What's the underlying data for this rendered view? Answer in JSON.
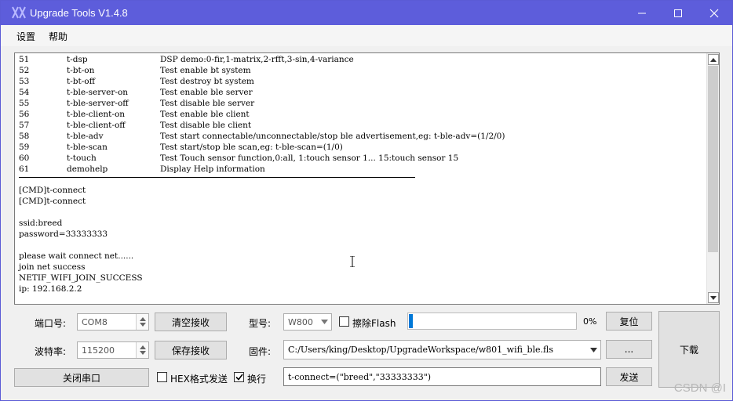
{
  "window": {
    "title": "Upgrade Tools V1.4.8"
  },
  "menu": [
    {
      "label": "设置"
    },
    {
      "label": "帮助"
    }
  ],
  "console": {
    "commands": [
      {
        "num": "51",
        "name": "t-dsp",
        "desc": "DSP demo:0-fir,1-matrix,2-rfft,3-sin,4-variance"
      },
      {
        "num": "52",
        "name": "t-bt-on",
        "desc": "Test enable bt system"
      },
      {
        "num": "53",
        "name": "t-bt-off",
        "desc": "Test destroy bt system"
      },
      {
        "num": "54",
        "name": "t-ble-server-on",
        "desc": "Test enable ble server"
      },
      {
        "num": "55",
        "name": "t-ble-server-off",
        "desc": "Test disable ble server"
      },
      {
        "num": "56",
        "name": "t-ble-client-on",
        "desc": "Test enable ble client"
      },
      {
        "num": "57",
        "name": "t-ble-client-off",
        "desc": "Test disable ble client"
      },
      {
        "num": "58",
        "name": "t-ble-adv",
        "desc": "Test start connectable/unconnectable/stop ble advertisement,eg: t-ble-adv=(1/2/0)"
      },
      {
        "num": "59",
        "name": "t-ble-scan",
        "desc": "Test start/stop ble scan,eg: t-ble-scan=(1/0)"
      },
      {
        "num": "60",
        "name": "t-touch",
        "desc": "Test Touch sensor function,0:all, 1:touch sensor 1... 15:touch sensor 15"
      },
      {
        "num": "61",
        "name": "demohelp",
        "desc": "Display Help information"
      }
    ],
    "log": [
      "[CMD]t-connect",
      "[CMD]t-connect",
      "",
      "ssid:breed",
      "password=33333333",
      "",
      "please wait connect net......",
      "join net success",
      "NETIF_WIFI_JOIN_SUCCESS",
      "ip: 192.168.2.2"
    ]
  },
  "controls": {
    "port_label": "端口号:",
    "port_value": "COM8",
    "baud_label": "波特率:",
    "baud_value": "115200",
    "clear_recv": "清空接收",
    "save_recv": "保存接收",
    "model_label": "型号:",
    "model_value": "W800",
    "erase_flash_label": "擦除Flash",
    "erase_flash_checked": false,
    "progress_percent": 0,
    "progress_text": "0%",
    "reset_button": "复位",
    "firmware_label": "固件:",
    "firmware_path": "C:/Users/king/Desktop/UpgradeWorkspace/w801_wifi_ble.fls",
    "browse_button": "...",
    "download_button": "下载",
    "close_port_button": "关闭串口",
    "hex_send_label": "HEX格式发送",
    "hex_send_checked": false,
    "newline_label": "换行",
    "newline_checked": true,
    "send_input": "t-connect=(\"breed\",\"33333333\")",
    "send_button": "发送"
  },
  "watermark": "CSDN @I",
  "colors": {
    "titlebar": "#5d5ddb",
    "progress": "#0078d7"
  }
}
